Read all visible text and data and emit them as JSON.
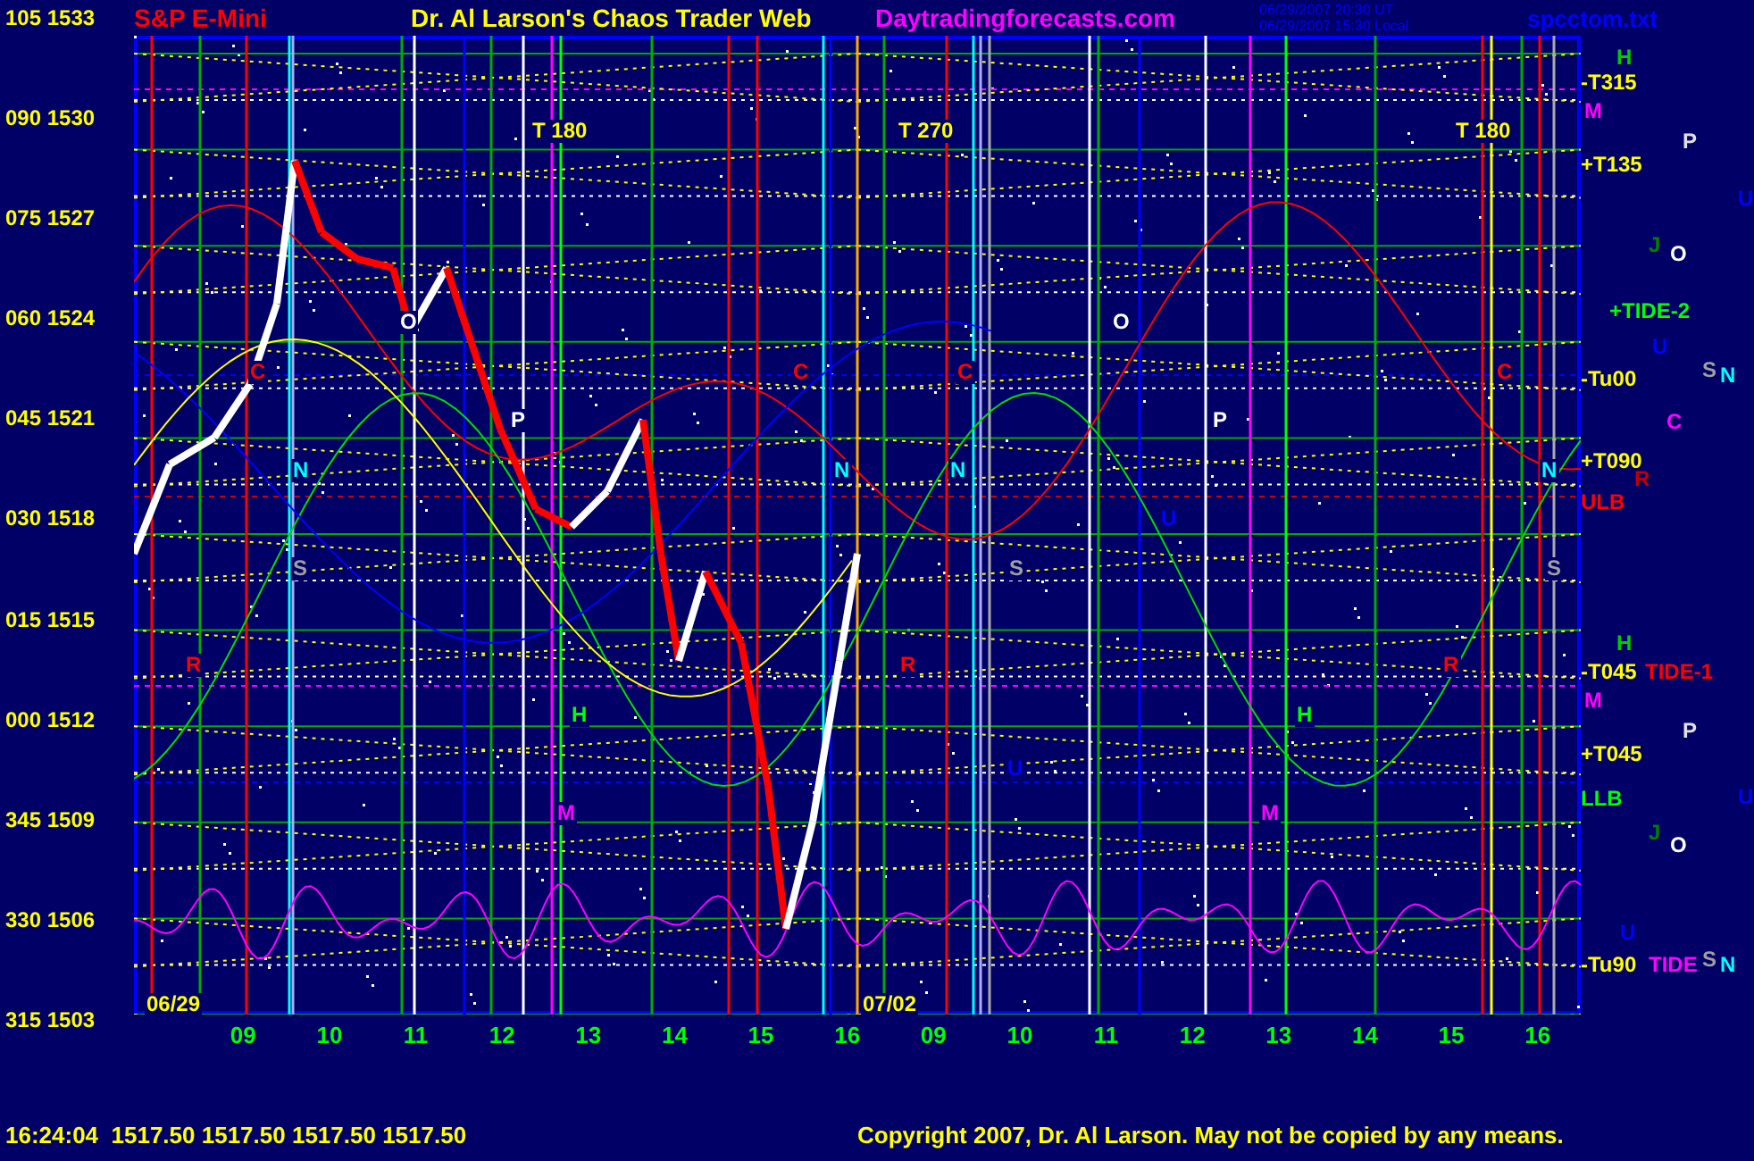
{
  "header": {
    "instrument": "S&P E-Mini",
    "title": "Dr. Al Larson's Chaos Trader Web",
    "site": "Daytradingforecasts.com",
    "timestamps": [
      "06/29/2007 20:30 UT",
      "06/29/2007 15:30 Local"
    ],
    "file": "spcctom.txt"
  },
  "y_axis_labels": [
    "105 1533",
    "090 1530",
    "075 1527",
    "060 1524",
    "045 1521",
    "030 1518",
    "015 1515",
    "000 1512",
    "345 1509",
    "330 1506",
    "315 1503"
  ],
  "plot_labels": [
    {
      "text": "T 180",
      "color": "#ffff00"
    },
    {
      "text": "T 270",
      "color": "#ffff00"
    },
    {
      "text": "T 180",
      "color": "#ffff00"
    },
    {
      "text": "06/29",
      "color": "#ffff00"
    },
    {
      "text": "07/02",
      "color": "#ffff00"
    },
    {
      "text": "O",
      "color": "#ffffff"
    },
    {
      "text": "O",
      "color": "#ffffff"
    },
    {
      "text": "P",
      "color": "#ffffff"
    },
    {
      "text": "P",
      "color": "#ffffff"
    },
    {
      "text": "C",
      "color": "#ff0000"
    },
    {
      "text": "C",
      "color": "#ff0000"
    },
    {
      "text": "C",
      "color": "#ff0000"
    },
    {
      "text": "C",
      "color": "#ff0000"
    },
    {
      "text": "N",
      "color": "#00ffff"
    },
    {
      "text": "N",
      "color": "#00ffff"
    },
    {
      "text": "N",
      "color": "#00ffff"
    },
    {
      "text": "N",
      "color": "#00ffff"
    },
    {
      "text": "S",
      "color": "#a0a0a0"
    },
    {
      "text": "S",
      "color": "#a0a0a0"
    },
    {
      "text": "S",
      "color": "#a0a0a0"
    },
    {
      "text": "M",
      "color": "#ff00ff"
    },
    {
      "text": "M",
      "color": "#ff00ff"
    },
    {
      "text": "H",
      "color": "#00ff00"
    },
    {
      "text": "H",
      "color": "#00ff00"
    },
    {
      "text": "R",
      "color": "#ff0000"
    },
    {
      "text": "R",
      "color": "#ff0000"
    },
    {
      "text": "R",
      "color": "#ff0000"
    },
    {
      "text": "U",
      "color": "#0000ff"
    },
    {
      "text": "U",
      "color": "#0000ff"
    }
  ],
  "right_labels": [
    {
      "text": "H",
      "color": "#00cc00"
    },
    {
      "text": "-T315",
      "color": "#ffff00"
    },
    {
      "text": "M",
      "color": "#ff00ff"
    },
    {
      "text": "P",
      "color": "#e0e0e0"
    },
    {
      "text": "+T135",
      "color": "#ffff00"
    },
    {
      "text": "U",
      "color": "#0000ff"
    },
    {
      "text": "J",
      "color": "#008000"
    },
    {
      "text": "O",
      "color": "#ffffff"
    },
    {
      "text": "+TIDE-2",
      "color": "#00ff00"
    },
    {
      "text": "U",
      "color": "#0000ff"
    },
    {
      "text": "-Tu00",
      "color": "#ffff00"
    },
    {
      "text": "S",
      "color": "#a0a0a0"
    },
    {
      "text": "N",
      "color": "#00ffff"
    },
    {
      "text": "C",
      "color": "#ff00ff"
    },
    {
      "text": "+T090",
      "color": "#ffff00"
    },
    {
      "text": "R",
      "color": "#c00000"
    },
    {
      "text": "ULB",
      "color": "#ff0000"
    },
    {
      "text": "H",
      "color": "#00cc00"
    },
    {
      "text": "-T045",
      "color": "#ffff00"
    },
    {
      "text": "TIDE-1",
      "color": "#ff0000"
    },
    {
      "text": "M",
      "color": "#ff00ff"
    },
    {
      "text": "P",
      "color": "#e0e0e0"
    },
    {
      "text": "+T045",
      "color": "#ffff00"
    },
    {
      "text": "U",
      "color": "#0000ff"
    },
    {
      "text": "LLB",
      "color": "#00ff00"
    },
    {
      "text": "J",
      "color": "#008000"
    },
    {
      "text": "O",
      "color": "#ffffff"
    },
    {
      "text": "U",
      "color": "#0000ff"
    },
    {
      "text": "-Tu90",
      "color": "#ffff00"
    },
    {
      "text": "TIDE",
      "color": "#ff00ff"
    },
    {
      "text": "S",
      "color": "#a0a0a0"
    },
    {
      "text": "N",
      "color": "#00ffff"
    }
  ],
  "x_axis_labels": [
    "09",
    "10",
    "11",
    "12",
    "13",
    "14",
    "15",
    "16",
    "09",
    "10",
    "11",
    "12",
    "13",
    "14",
    "15",
    "16"
  ],
  "footer": {
    "quote": "16:24:04  1517.50 1517.50 1517.50 1517.50",
    "copyright": "Copyright 2007, Dr. Al Larson. May not be copied by any means."
  }
}
